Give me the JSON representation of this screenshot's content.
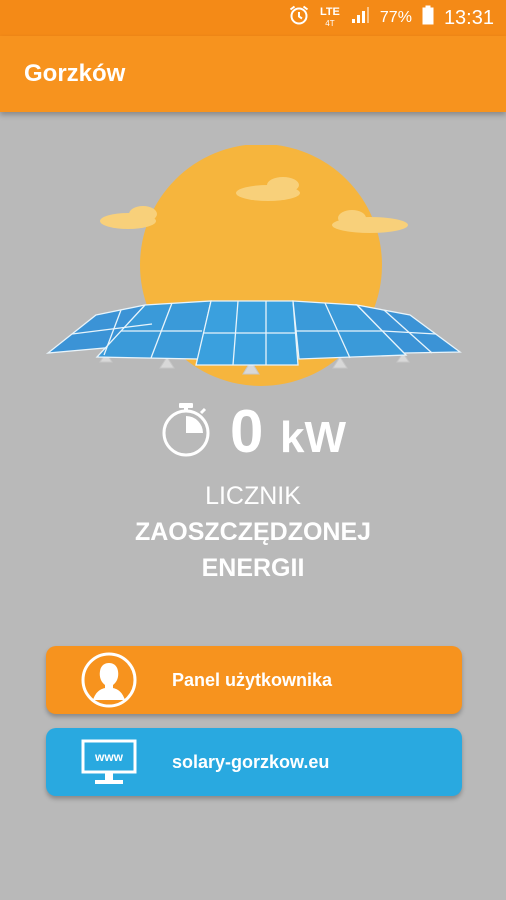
{
  "status_bar": {
    "network": "LTE",
    "network_sub": "4T",
    "battery": "77%",
    "time": "13:31",
    "icons": [
      "alarm-icon",
      "lte-icon",
      "signal-icon",
      "battery-icon"
    ]
  },
  "app_bar": {
    "title": "Gorzków"
  },
  "hero": {
    "icon": "sun-solar-panels-illustration"
  },
  "counter": {
    "icon": "stopwatch-icon",
    "value": "0",
    "unit": "kW"
  },
  "caption": {
    "line1": "LICZNIK",
    "line2": "ZAOSZCZĘDZONEJ",
    "line3": "ENERGII"
  },
  "buttons": {
    "user_panel": {
      "label": "Panel użytkownika",
      "icon": "user-avatar-icon"
    },
    "website": {
      "label": "solary-gorzkow.eu",
      "icon": "www-monitor-icon",
      "icon_text": "www"
    }
  },
  "colors": {
    "primary": "#f7931e",
    "status_bar": "#f48a17",
    "background": "#b9b9b9",
    "blue": "#29a9e0",
    "sun": "#f6b53d"
  }
}
